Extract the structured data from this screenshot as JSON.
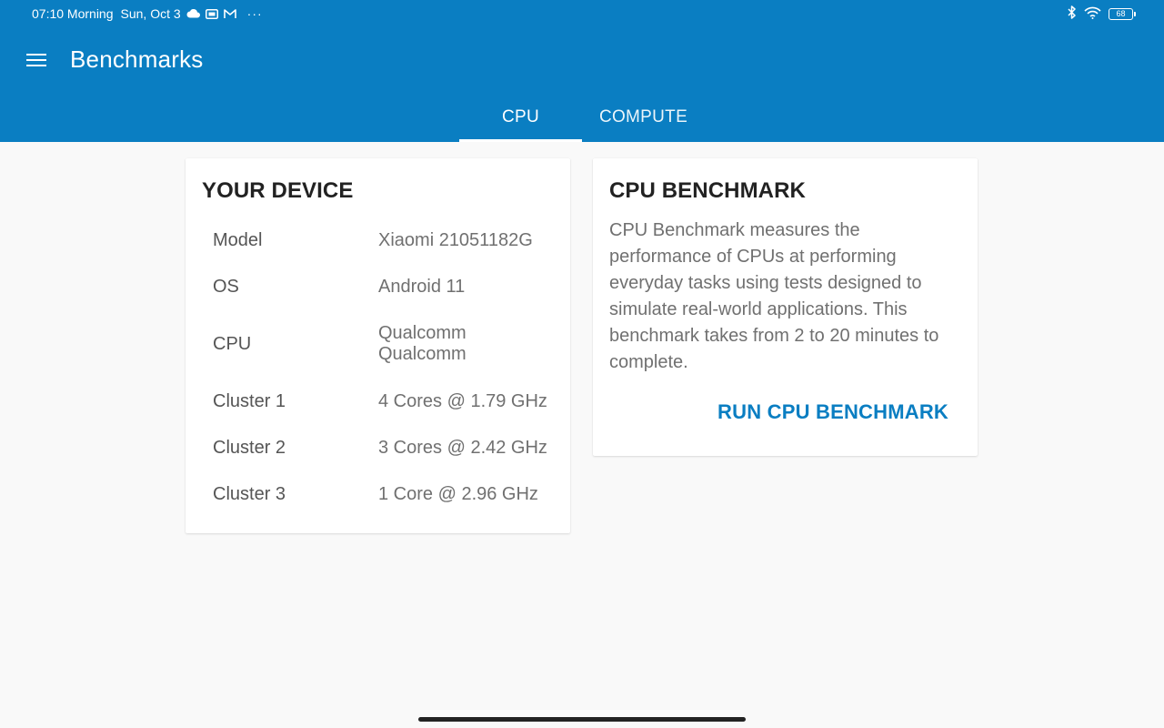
{
  "status_bar": {
    "time": "07:10 Morning",
    "date": "Sun, Oct 3",
    "battery": "68",
    "icons": [
      "cloud-icon",
      "sim-badge-icon",
      "mail-icon",
      "more-dots-icon",
      "bluetooth-icon",
      "wifi-icon",
      "battery-icon"
    ],
    "more": "···"
  },
  "toolbar": {
    "title": "Benchmarks",
    "menu_icon": "hamburger-menu-icon"
  },
  "tabs": [
    {
      "label": "CPU",
      "active": true
    },
    {
      "label": "COMPUTE",
      "active": false
    }
  ],
  "device": {
    "title": "YOUR DEVICE",
    "rows": [
      {
        "label": "Model",
        "value": "Xiaomi 21051182G"
      },
      {
        "label": "OS",
        "value": "Android 11"
      },
      {
        "label": "CPU",
        "value": "Qualcomm",
        "value2": "Qualcomm"
      },
      {
        "label": "Cluster 1",
        "value": "4 Cores @ 1.79 GHz"
      },
      {
        "label": "Cluster 2",
        "value": "3 Cores @ 2.42 GHz"
      },
      {
        "label": "Cluster 3",
        "value": "1 Core @ 2.96 GHz"
      }
    ]
  },
  "benchmark": {
    "title": "CPU BENCHMARK",
    "description": "CPU Benchmark measures the performance of CPUs at performing everyday tasks using tests designed to simulate real-world applications. This benchmark takes from 2 to 20 minutes to complete.",
    "run_label": "RUN CPU BENCHMARK"
  },
  "colors": {
    "primary": "#0a7ec2",
    "background": "#f9f9f9",
    "card": "#ffffff"
  }
}
